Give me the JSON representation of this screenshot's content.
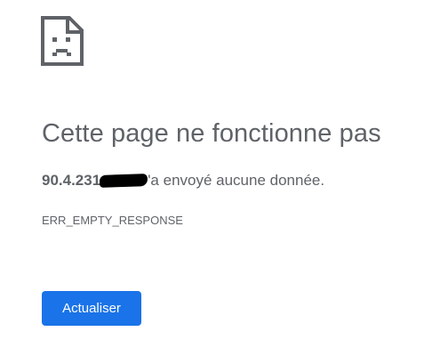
{
  "error": {
    "icon": "sad-page-icon",
    "title": "Cette page ne fonctionne pas",
    "host": "90.4.231",
    "message_rest": "'a envoyé aucune donnée.",
    "code": "ERR_EMPTY_RESPONSE"
  },
  "actions": {
    "reload_label": "Actualiser"
  },
  "colors": {
    "text": "#5f6368",
    "button": "#1a73e8",
    "button_text": "#ffffff"
  }
}
